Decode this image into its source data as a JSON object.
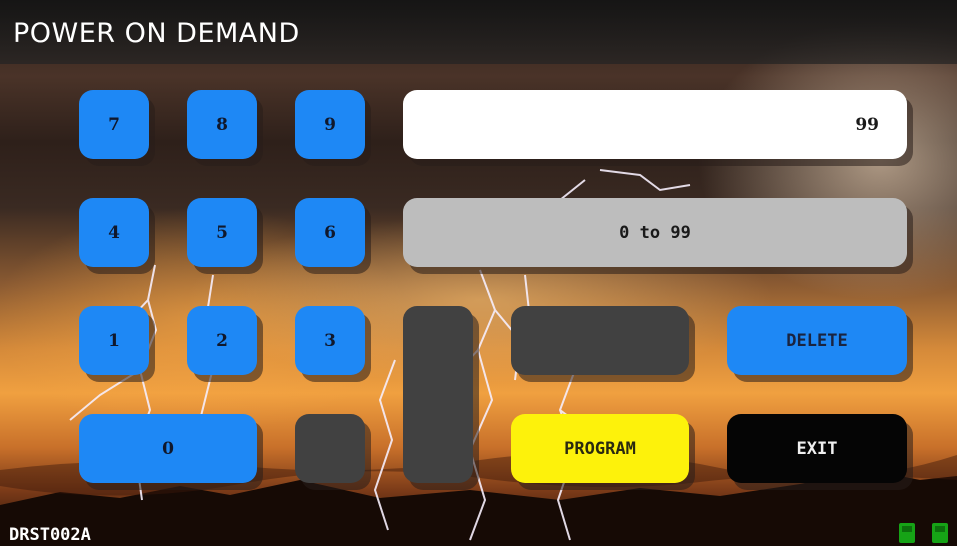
{
  "title": "POWER ON DEMAND",
  "keypad": {
    "keys": [
      "7",
      "8",
      "9",
      "4",
      "5",
      "6",
      "1",
      "2",
      "3",
      "0"
    ]
  },
  "value_field": {
    "value": "99"
  },
  "range_field": {
    "text": "0 to 99"
  },
  "buttons": {
    "delete": "DELETE",
    "program": "PROGRAM",
    "exit": "EXIT"
  },
  "footer": {
    "device_id": "DRST002A"
  },
  "colors": {
    "key_blue": "#1e88f5",
    "program_yellow": "#fdf20b",
    "exit_black": "#050505",
    "disabled_gray": "#414141",
    "status_green": "#16a316"
  },
  "icons": [
    "sd-card-icon",
    "memory-chip-icon"
  ]
}
